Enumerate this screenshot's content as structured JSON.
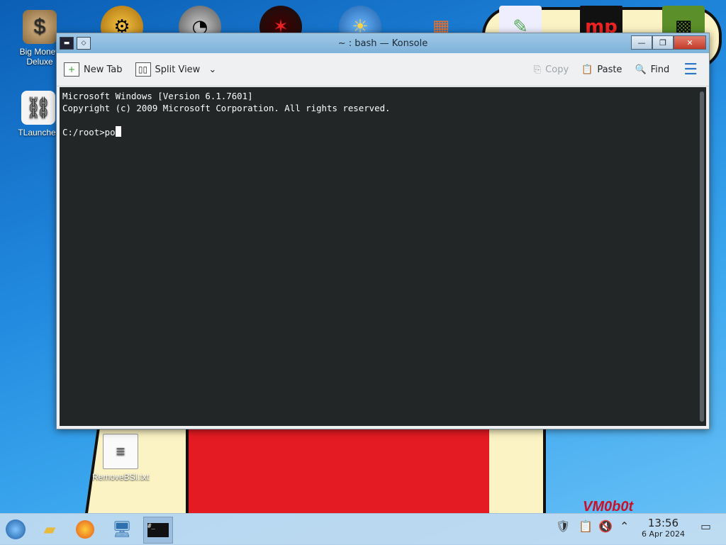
{
  "desktop": {
    "icons": [
      {
        "label": "Big Money\nDeluxe"
      },
      {
        "label": "TLauncher"
      },
      {
        "label": "RemoveBSI.txt"
      }
    ],
    "watermark": "VM0b0t"
  },
  "window": {
    "title": "~ : bash — Konsole",
    "buttons": {
      "minimize": "—",
      "maximize": "❐",
      "close": "✕"
    }
  },
  "toolbar": {
    "new_tab": "New Tab",
    "split_view": "Split View",
    "copy": "Copy",
    "paste": "Paste",
    "find": "Find"
  },
  "terminal": {
    "lines": [
      "Microsoft Windows [Version 6.1.7601]",
      "Copyright (c) 2009 Microsoft Corporation. All rights reserved.",
      "",
      "C:/root>po"
    ]
  },
  "taskbar": {
    "clock_time": "13:56",
    "clock_date": "6 Apr 2024"
  }
}
